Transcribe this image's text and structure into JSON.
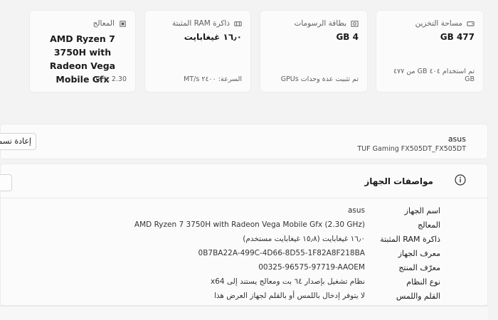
{
  "cards": {
    "storage": {
      "title": "مساحة التخزين",
      "value": "477 GB",
      "footer": "تم استخدام ٤٠٤ GB من ٤٧٧ GB",
      "icon": "storage-icon"
    },
    "gpu": {
      "title": "بطاقة الرسومات",
      "value": "4 GB",
      "footer": "تم تثبيت عدة وحدات GPUs",
      "icon": "gpu-icon"
    },
    "ram": {
      "title": "ذاكرة RAM المثبتة",
      "value": "١٦٫٠ غيغابايت",
      "footer": "السرعة: ٢٤٠٠ MT/s",
      "icon": "ram-icon"
    },
    "cpu": {
      "title": "المعالج",
      "value": "AMD Ryzen 7 3750H with Radeon Vega Mobile Gfx",
      "footer": "2.30 GHz",
      "icon": "cpu-icon"
    }
  },
  "device": {
    "name": "asus",
    "model": "TUF Gaming FX505DT_FX505DT",
    "rename_label": "إعادة تسمية"
  },
  "specs": {
    "title": "مواصفات الجهاز",
    "rows": [
      {
        "label": "اسم الجهاز",
        "value": "asus"
      },
      {
        "label": "المعالج",
        "value": "AMD Ryzen 7 3750H with Radeon Vega Mobile Gfx   (2.30 GHz)"
      },
      {
        "label": "ذاكرة RAM المثبتة",
        "value": "١٦٫٠ غيغابايت (١٥٫٨ غيغابايت مستخدم)"
      },
      {
        "label": "معرف الجهاز",
        "value": "0B7BA22A-499C-4D66-8D55-1F82A8F218BA"
      },
      {
        "label": "معرّف المنتج",
        "value": "00325-96575-97719-AAOEM"
      },
      {
        "label": "نوع النظام",
        "value": "نظام تشغيل بإصدار ٦٤ بت ومعالج يستند إلى x64"
      },
      {
        "label": "القلم واللمس",
        "value": "لا يتوفر إدخال باللمس أو بالقلم لجهاز العرض هذا"
      }
    ]
  },
  "colors": {
    "background": "#f3f3f3",
    "card": "#fbfbfb",
    "border": "#ececec"
  }
}
